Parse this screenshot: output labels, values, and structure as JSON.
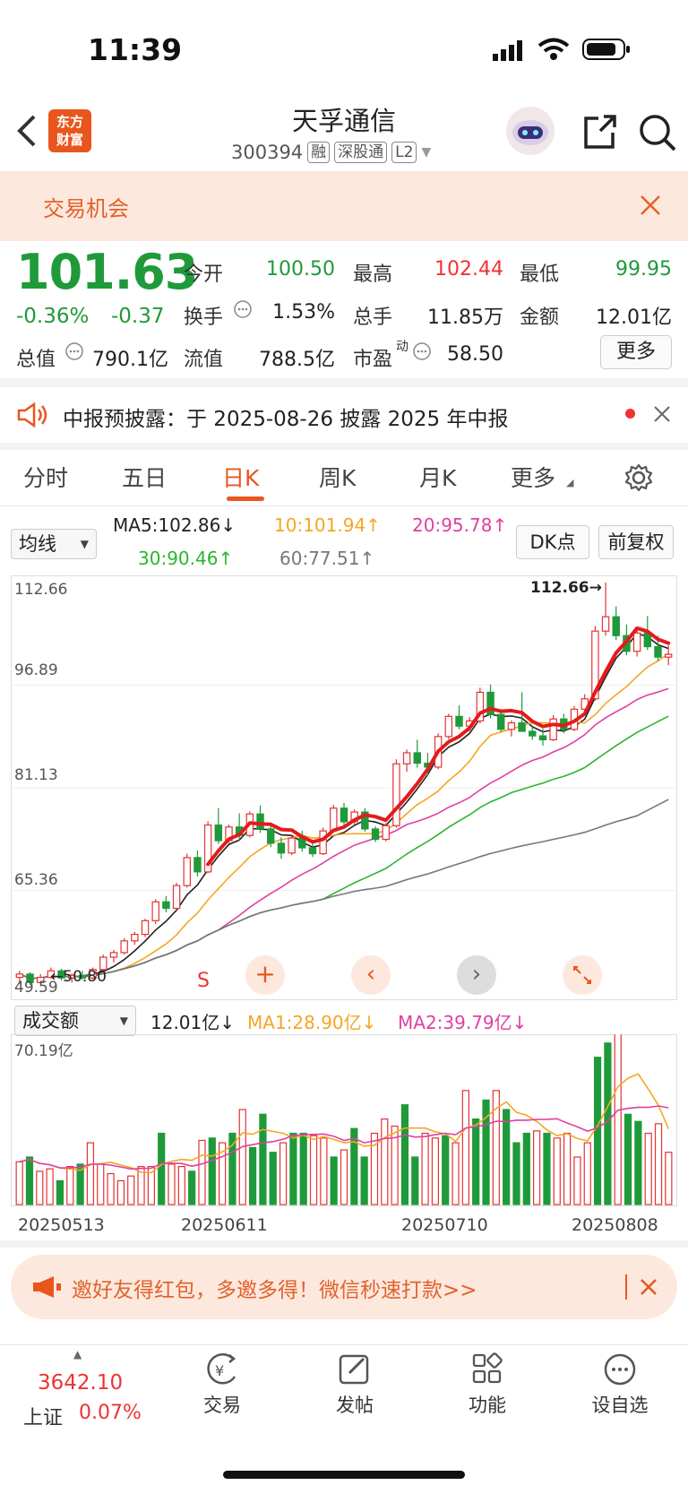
{
  "status_bar": {
    "time": "11:39"
  },
  "header": {
    "back_label": "<",
    "logo_line1": "东方",
    "logo_line2": "财富",
    "title": "天孚通信",
    "code": "300394",
    "tags": [
      "融",
      "深股通",
      "L2"
    ]
  },
  "opportunity_banner": {
    "text": "交易机会"
  },
  "quote": {
    "price": "101.63",
    "change_pct": "-0.36%",
    "change": "-0.37",
    "open_label": "今开",
    "open": "100.50",
    "high_label": "最高",
    "high": "102.44",
    "low_label": "最低",
    "low": "99.95",
    "turnover_label": "换手",
    "turnover": "1.53%",
    "volume_label": "总手",
    "volume": "11.85万",
    "amount_label": "金额",
    "amount": "12.01亿",
    "mktcap_label": "总值",
    "mktcap": "790.1亿",
    "float_label": "流值",
    "float": "788.5亿",
    "pe_label": "市盈",
    "pe_sup": "动",
    "pe": "58.50",
    "more_label": "更多"
  },
  "notice": {
    "text": "中报预披露：于 2025-08-26 披露 2025 年中报"
  },
  "tabs": [
    {
      "label": "分时"
    },
    {
      "label": "五日"
    },
    {
      "label": "日K"
    },
    {
      "label": "周K"
    },
    {
      "label": "月K"
    },
    {
      "label": "更多"
    }
  ],
  "indicator": {
    "ma_select": "均线",
    "ma5": "MA5:102.86↓",
    "ma10": "10:101.94↑",
    "ma20": "20:95.78↑",
    "ma30": "30:90.46↑",
    "ma60": "60:77.51↑",
    "dk_label": "DK点",
    "adjust_label": "前复权"
  },
  "colors": {
    "up": "#e33333",
    "down": "#1f9a3a",
    "ma5": "#222222",
    "ma10": "#f5a623",
    "ma20": "#e040a0",
    "ma30": "#2db52d",
    "ma60": "#777777",
    "accent": "#e8561e"
  },
  "chart_data": {
    "type": "candlestick",
    "y_ticks": [
      "112.66",
      "96.89",
      "81.13",
      "65.36",
      "49.59"
    ],
    "ylim": [
      49.59,
      112.66
    ],
    "max_marker": "112.66",
    "low_marker": "50.80",
    "x_labels": [
      "20250513",
      "20250611",
      "20250710",
      "20250808"
    ],
    "candles": [
      [
        52,
        53,
        51,
        52.5
      ],
      [
        52.5,
        52.8,
        50.8,
        51.2
      ],
      [
        51.2,
        52.5,
        50.9,
        52
      ],
      [
        52,
        53.5,
        51.8,
        53
      ],
      [
        53,
        53.3,
        51.5,
        51.9
      ],
      [
        51.9,
        52.6,
        51.2,
        52.3
      ],
      [
        52.3,
        53,
        51.6,
        51.9
      ],
      [
        51.9,
        53.5,
        51.7,
        53.2
      ],
      [
        53.2,
        55.5,
        53,
        55.1
      ],
      [
        55.1,
        56.2,
        54.3,
        55.8
      ],
      [
        55.8,
        58,
        55.5,
        57.6
      ],
      [
        57.6,
        59,
        57,
        58.6
      ],
      [
        58.6,
        61,
        58.2,
        60.7
      ],
      [
        60.7,
        64,
        60.2,
        63.6
      ],
      [
        63.6,
        64.5,
        62,
        62.6
      ],
      [
        62.6,
        66.5,
        62.3,
        66.1
      ],
      [
        66.1,
        71,
        65.8,
        70.4
      ],
      [
        70.4,
        71.5,
        67.5,
        68.2
      ],
      [
        68.2,
        76,
        68,
        75.4
      ],
      [
        75.4,
        78,
        72.5,
        73
      ],
      [
        73,
        75.5,
        72.6,
        75.1
      ],
      [
        75.1,
        77.2,
        73,
        73.8
      ],
      [
        73.8,
        77.5,
        73.5,
        77.1
      ],
      [
        77.1,
        78.4,
        74.2,
        74.8
      ],
      [
        74.8,
        75.5,
        72,
        72.6
      ],
      [
        72.6,
        73.5,
        70.2,
        71.1
      ],
      [
        71.1,
        73.8,
        70.8,
        73.4
      ],
      [
        73.4,
        74.5,
        71.3,
        71.9
      ],
      [
        71.9,
        73,
        70.5,
        71
      ],
      [
        71,
        75,
        70.8,
        74.5
      ],
      [
        74.5,
        78.5,
        74.2,
        78
      ],
      [
        78,
        78.8,
        75.3,
        75.9
      ],
      [
        75.9,
        77.8,
        75.5,
        77.4
      ],
      [
        77.4,
        78,
        74.4,
        74.8
      ],
      [
        74.8,
        75.2,
        72.8,
        73.2
      ],
      [
        73.2,
        75.7,
        72.9,
        75.3
      ],
      [
        75.3,
        85.5,
        75,
        84.8
      ],
      [
        84.8,
        87,
        83.6,
        86.5
      ],
      [
        86.5,
        88.5,
        84.2,
        84.9
      ],
      [
        84.9,
        86.5,
        83,
        84.3
      ],
      [
        84.3,
        89.5,
        84,
        89
      ],
      [
        89,
        92.5,
        88.6,
        92.1
      ],
      [
        92.1,
        93.8,
        90.1,
        90.6
      ],
      [
        90.6,
        92,
        89.8,
        91.4
      ],
      [
        91.4,
        96.5,
        91,
        95.8
      ],
      [
        95.8,
        97,
        91.8,
        92.4
      ],
      [
        92.4,
        93.2,
        89.7,
        90.1
      ],
      [
        90.1,
        91.5,
        89,
        91.1
      ],
      [
        91.1,
        95.8,
        90.8,
        89.8
      ],
      [
        89.8,
        90.5,
        88.5,
        89.1
      ],
      [
        89.1,
        90.2,
        87.6,
        88.5
      ],
      [
        88.5,
        92.3,
        88.3,
        91.7
      ],
      [
        91.7,
        92.5,
        89.5,
        90.1
      ],
      [
        90.1,
        93.7,
        89.8,
        93.2
      ],
      [
        93.2,
        95.5,
        92.9,
        94.8
      ],
      [
        94.8,
        106,
        94.5,
        105.2
      ],
      [
        105.2,
        112.66,
        104.5,
        107.4
      ],
      [
        107.4,
        109,
        103.8,
        104.5
      ],
      [
        104.5,
        106.2,
        101.5,
        102.1
      ],
      [
        102.1,
        105.5,
        101.3,
        104.9
      ],
      [
        104.9,
        107.5,
        102.3,
        102.8
      ],
      [
        102.8,
        104.5,
        100.6,
        101.2
      ],
      [
        101.2,
        103,
        99.95,
        101.63
      ]
    ],
    "volume": {
      "selector": "成交额",
      "current": "12.01亿↓",
      "ma1": "MA1:28.90亿↓",
      "ma2": "MA2:39.79亿↓",
      "top_label": "70.19亿",
      "max": 70.19,
      "unit": "亿",
      "values": [
        18,
        20,
        14,
        15,
        10,
        16,
        17,
        26,
        17,
        13,
        10,
        12,
        16,
        16,
        30,
        17,
        16,
        14,
        27,
        28,
        26,
        30,
        40,
        24,
        38,
        22,
        26,
        30,
        30,
        29,
        28,
        20,
        23,
        32,
        20,
        30,
        36,
        33,
        42,
        20,
        30,
        28,
        29,
        26,
        48,
        36,
        44,
        48,
        40,
        26,
        30,
        31,
        30,
        28,
        30,
        20,
        26,
        62,
        68,
        72,
        38,
        35,
        30,
        34,
        22
      ]
    }
  },
  "hint_banner": {
    "text": "邀好友得红包，多邀多得！微信秒速打款>>"
  },
  "bottom_nav": {
    "index_value": "3642.10",
    "index_name": "上证",
    "index_change": "0.07%",
    "items": [
      {
        "label": "交易"
      },
      {
        "label": "发帖"
      },
      {
        "label": "功能"
      },
      {
        "label": "设自选"
      }
    ]
  }
}
